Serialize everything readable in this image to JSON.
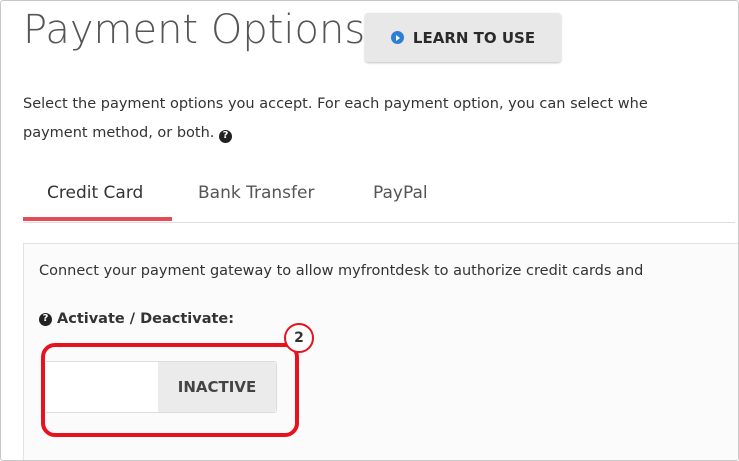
{
  "page": {
    "title": "Payment Options",
    "learn_button_label": "LEARN TO USE",
    "description_line1": "Select the payment options you accept. For each payment option, you can select whe",
    "description_line2": "payment method, or both. "
  },
  "tabs": [
    {
      "label": "Credit Card",
      "active": true
    },
    {
      "label": "Bank Transfer",
      "active": false
    },
    {
      "label": "PayPal",
      "active": false
    }
  ],
  "panel": {
    "connect_text": "Connect your payment gateway to allow myfrontdesk to authorize credit cards and",
    "activate_label": "Activate / Deactivate:",
    "toggle_state": "INACTIVE"
  },
  "annotation": {
    "step_number": "2"
  },
  "colors": {
    "accent_tab": "#e34b55",
    "annotation_red": "#e8121e",
    "play_icon_blue": "#2d7fd3"
  },
  "icons": {
    "learn_button": "play-circle-icon",
    "help": "question-circle-icon"
  }
}
